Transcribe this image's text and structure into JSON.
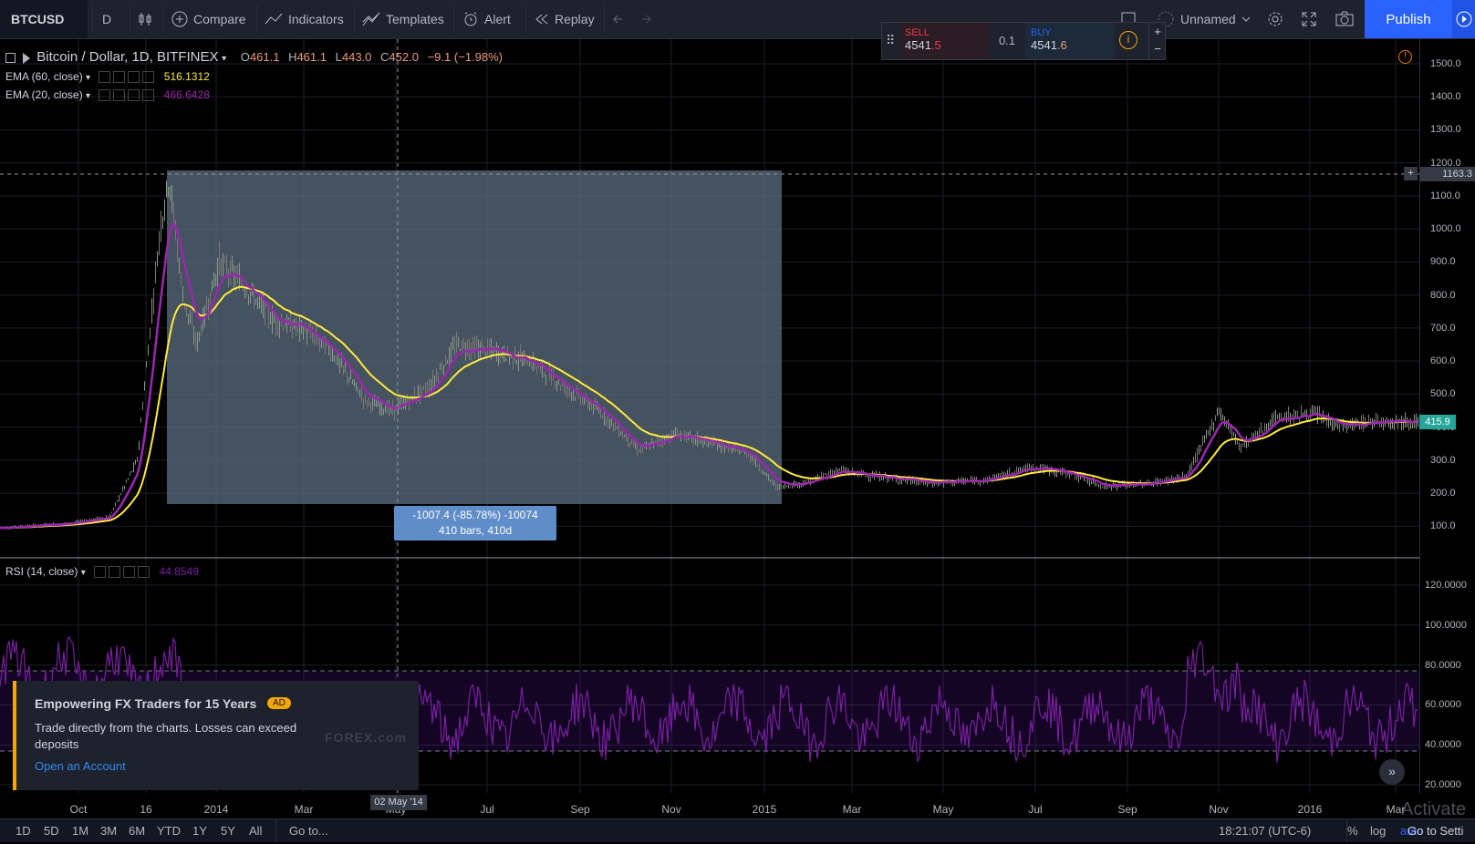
{
  "toolbar": {
    "symbol": "BTCUSD",
    "interval": "D",
    "compare": "Compare",
    "indicators": "Indicators",
    "templates": "Templates",
    "alert": "Alert",
    "replay": "Replay",
    "layout_name": "Unnamed",
    "publish": "Publish"
  },
  "trade_panel": {
    "sell_label": "SELL",
    "sell_price_main": "4541",
    "sell_price_frac": ".5",
    "quantity": "0.1",
    "buy_label": "BUY",
    "buy_price_main": "4541",
    "buy_price_frac": ".6"
  },
  "legend": {
    "title": "Bitcoin / Dollar, 1D, BITFINEX",
    "o_key": "O",
    "o_val": "461.1",
    "h_key": "H",
    "h_val": "461.1",
    "l_key": "L",
    "l_val": "443.0",
    "c_key": "C",
    "c_val": "452.0",
    "change": "−9.1 (−1.98%)",
    "ema60_label": "EMA (60, close)",
    "ema60_value": "516.1312",
    "ema20_label": "EMA (20, close)",
    "ema20_value": "466.6428",
    "rsi_label": "RSI (14, close)",
    "rsi_value": "44.8549"
  },
  "measure": {
    "line1": "-1007.4 (-85.78%) -10074",
    "line2": "410 bars, 410d"
  },
  "price_axis": {
    "ticks": [
      "1500.0",
      "1400.0",
      "1300.0",
      "1200.0",
      "1100.0",
      "1000.0",
      "900.0",
      "800.0",
      "700.0",
      "600.0",
      "500.0",
      "400.0",
      "300.0",
      "200.0",
      "100.0"
    ],
    "crosshair_price": "1163.3",
    "last_price": "415.9"
  },
  "rsi_axis": {
    "ticks": [
      "120.0000",
      "100.0000",
      "80.0000",
      "60.0000",
      "40.0000",
      "20.0000"
    ]
  },
  "time_axis": {
    "labels": [
      "Oct",
      "16",
      "2014",
      "Mar",
      "May",
      "Jul",
      "Sep",
      "Nov",
      "2015",
      "Mar",
      "May",
      "Jul",
      "Sep",
      "Nov",
      "2016",
      "Mar"
    ],
    "crosshair_date": "02 May '14"
  },
  "ad": {
    "title": "Empowering FX Traders for 15 Years",
    "badge": "AD",
    "body": "Trade directly from the charts. Losses can exceed deposits",
    "link": "Open an Account",
    "brand": "FOREX.com"
  },
  "bottom_bar": {
    "ranges": [
      "1D",
      "5D",
      "1M",
      "3M",
      "6M",
      "YTD",
      "1Y",
      "5Y",
      "All"
    ],
    "goto": "Go to...",
    "clock": "18:21:07 (UTC-6)",
    "percent": "%",
    "log": "log",
    "auto": "auto",
    "overlay_text": "Go to Setti",
    "watermark": "Activate"
  },
  "colors": {
    "ema60": "#ffeb3b",
    "ema20": "#9c27b0",
    "rsi": "#7b1fa2",
    "accent": "#2962ff",
    "sell": "#f23645",
    "buy": "#2962ff",
    "last_price_bg": "#26a69a"
  }
}
